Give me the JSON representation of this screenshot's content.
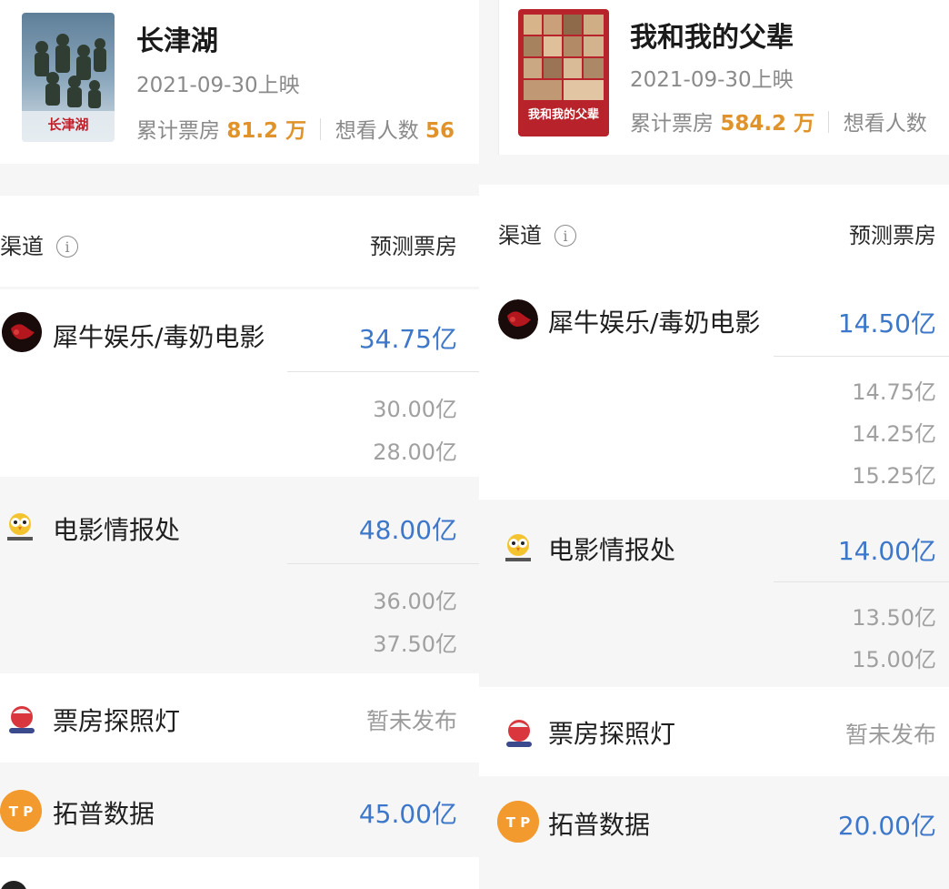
{
  "columns": [
    {
      "movie": {
        "title": "长津湖",
        "date": "2021-09-30上映",
        "box_label": "累计票房",
        "box_value": "81.2 万",
        "want_label": "想看人数",
        "want_value": "56",
        "poster_text": "长津湖"
      },
      "header": {
        "channel": "渠道",
        "forecast": "预测票房"
      },
      "rows": [
        {
          "name": "犀牛娱乐/毒奶电影",
          "value": "34.75亿",
          "subs": [
            "30.00亿",
            "28.00亿"
          ]
        },
        {
          "name": "电影情报处",
          "value": "48.00亿",
          "subs": [
            "36.00亿",
            "37.50亿"
          ]
        },
        {
          "name": "票房探照灯",
          "value": "暂未发布",
          "subs": []
        },
        {
          "name": "拓普数据",
          "value": "45.00亿",
          "subs": []
        }
      ]
    },
    {
      "movie": {
        "title": "我和我的父辈",
        "date": "2021-09-30上映",
        "box_label": "累计票房",
        "box_value": "584.2 万",
        "want_label": "想看人数",
        "want_value": "",
        "poster_text": "我和我的父辈"
      },
      "header": {
        "channel": "渠道",
        "forecast": "预测票房"
      },
      "rows": [
        {
          "name": "犀牛娱乐/毒奶电影",
          "value": "14.50亿",
          "subs": [
            "14.75亿",
            "14.25亿",
            "15.25亿"
          ]
        },
        {
          "name": "电影情报处",
          "value": "14.00亿",
          "subs": [
            "13.50亿",
            "15.00亿"
          ]
        },
        {
          "name": "票房探照灯",
          "value": "暂未发布",
          "subs": []
        },
        {
          "name": "拓普数据",
          "value": "20.00亿",
          "subs": []
        }
      ]
    }
  ],
  "logo_texts": {
    "topdata": "T P"
  },
  "colors": {
    "accent_blue": "#3d77c9",
    "box_orange": "#e0932a",
    "muted": "#9b9b9b"
  }
}
